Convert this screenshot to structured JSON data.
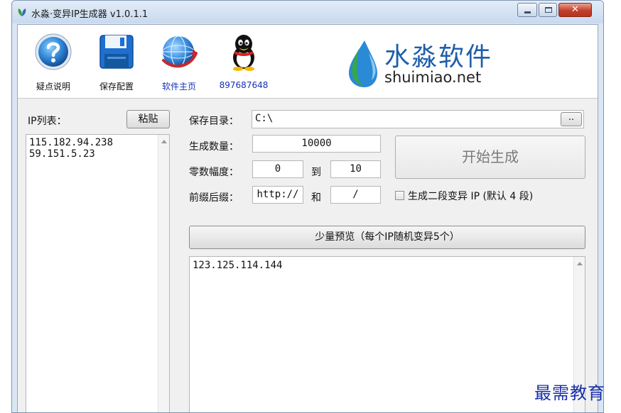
{
  "window": {
    "title": "水淼·变异IP生成器 v1.0.1.1",
    "close_glyph": "✕"
  },
  "toolbar": {
    "items": [
      {
        "label": "疑点说明",
        "icon": "help-icon"
      },
      {
        "label": "保存配置",
        "icon": "save-icon"
      },
      {
        "label": "软件主页",
        "icon": "globe-icon"
      },
      {
        "label": "897687648",
        "icon": "qq-penguin-icon"
      }
    ]
  },
  "logo": {
    "cn": "水淼软件",
    "en": "shuimiao.net"
  },
  "ip_list": {
    "label": "IP列表：",
    "paste_button": "粘贴",
    "lines": [
      "115.182.94.238",
      "59.151.5.23"
    ]
  },
  "form": {
    "save_dir_label": "保存目录：",
    "save_dir_value": "C:\\",
    "browse_button": "..",
    "count_label": "生成数量：",
    "count_value": "10000",
    "range_label": "零数幅度：",
    "range_from": "0",
    "range_to_label": "到",
    "range_to": "10",
    "prefix_suffix_label": "前缀后缀：",
    "prefix_value": "http://",
    "and_label": "和",
    "suffix_value": "/",
    "start_button": "开始生成",
    "two_segment_checkbox_label": "生成二段变异 IP (默认 4 段)",
    "two_segment_checked": false
  },
  "preview": {
    "button": "少量预览（每个IP随机变异5个）",
    "lines": [
      "123.125.114.144"
    ]
  },
  "watermark": "最需教育",
  "colors": {
    "title_bar": "#c9d9ee",
    "close_button": "#c2402a",
    "link_blue": "#1632b8",
    "logo_blue": "#1f5faa"
  }
}
